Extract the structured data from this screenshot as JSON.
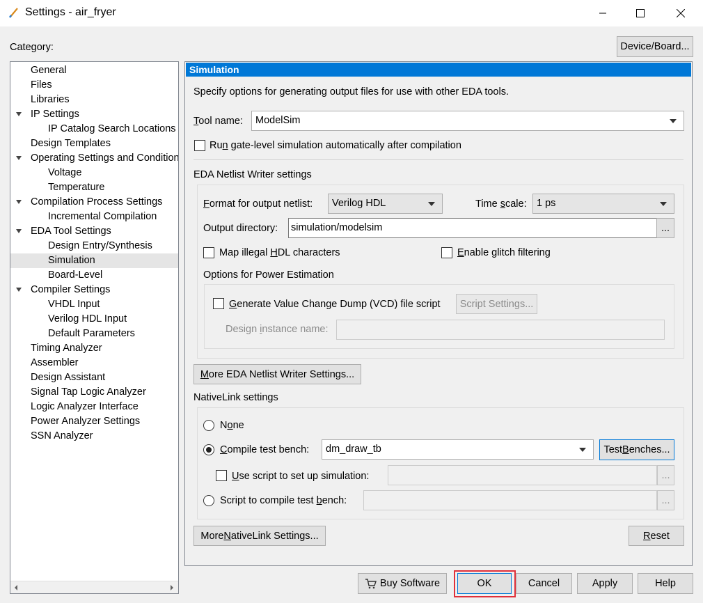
{
  "window": {
    "title": "Settings - air_fryer",
    "minimize": "—",
    "maximize": "☐",
    "close": "✕"
  },
  "category_label": "Category:",
  "device_board_button": "Device/Board...",
  "tree": [
    {
      "label": "General",
      "level": 0
    },
    {
      "label": "Files",
      "level": 0
    },
    {
      "label": "Libraries",
      "level": 0
    },
    {
      "label": "IP Settings",
      "level": 0,
      "expanded": true
    },
    {
      "label": "IP Catalog Search Locations",
      "level": 1
    },
    {
      "label": "Design Templates",
      "level": 0
    },
    {
      "label": "Operating Settings and Conditions",
      "level": 0,
      "expanded": true
    },
    {
      "label": "Voltage",
      "level": 1
    },
    {
      "label": "Temperature",
      "level": 1
    },
    {
      "label": "Compilation Process Settings",
      "level": 0,
      "expanded": true
    },
    {
      "label": "Incremental Compilation",
      "level": 1
    },
    {
      "label": "EDA Tool Settings",
      "level": 0,
      "expanded": true
    },
    {
      "label": "Design Entry/Synthesis",
      "level": 1
    },
    {
      "label": "Simulation",
      "level": 1,
      "selected": true
    },
    {
      "label": "Board-Level",
      "level": 1
    },
    {
      "label": "Compiler Settings",
      "level": 0,
      "expanded": true
    },
    {
      "label": "VHDL Input",
      "level": 1
    },
    {
      "label": "Verilog HDL Input",
      "level": 1
    },
    {
      "label": "Default Parameters",
      "level": 1
    },
    {
      "label": "Timing Analyzer",
      "level": 0
    },
    {
      "label": "Assembler",
      "level": 0
    },
    {
      "label": "Design Assistant",
      "level": 0
    },
    {
      "label": "Signal Tap Logic Analyzer",
      "level": 0
    },
    {
      "label": "Logic Analyzer Interface",
      "level": 0
    },
    {
      "label": "Power Analyzer Settings",
      "level": 0
    },
    {
      "label": "SSN Analyzer",
      "level": 0
    }
  ],
  "panel": {
    "header": "Simulation",
    "description": "Specify options for generating output files for use with other EDA tools.",
    "tool_name": {
      "label_key": "T",
      "label_rest": "ool name:",
      "value": "ModelSim"
    },
    "run_gate_level": {
      "pre": "Ru",
      "key": "n",
      "post": " gate-level simulation automatically after compilation"
    },
    "netlist_section": "EDA Netlist Writer settings",
    "format": {
      "key": "F",
      "rest": "ormat for output netlist:",
      "value": "Verilog HDL"
    },
    "timescale": {
      "pre": "Time ",
      "key": "s",
      "post": "cale:",
      "value": "1 ps"
    },
    "output_dir": {
      "label": "Output directory:",
      "value": "simulation/modelsim",
      "browse": "..."
    },
    "map_illegal": {
      "pre": "Map illegal ",
      "key": "H",
      "post": "DL characters"
    },
    "glitch": {
      "key": "E",
      "rest": "nable glitch filtering"
    },
    "power_section": "Options for Power Estimation",
    "vcd": {
      "key": "G",
      "rest": "enerate Value Change Dump (VCD) file script",
      "script_settings": "Script Settings..."
    },
    "design_instance": {
      "pre": "Design ",
      "key": "i",
      "post": "nstance name:",
      "value": ""
    },
    "more_netlist": {
      "pre": "",
      "key": "M",
      "post": "ore EDA Netlist Writer Settings..."
    },
    "nativelink_section": "NativeLink settings",
    "none": {
      "pre": "N",
      "key": "o",
      "post": "ne"
    },
    "compile_tb": {
      "key": "C",
      "rest": "ompile test bench:",
      "value": "dm_draw_tb",
      "test_benches_pre": "Test ",
      "test_benches_key": "B",
      "test_benches_post": "enches..."
    },
    "use_script": {
      "key": "U",
      "rest": "se script to set up simulation:",
      "value": "",
      "browse": "..."
    },
    "script_compile": {
      "pre": "Script to compile test ",
      "key": "b",
      "post": "ench:",
      "value": "",
      "browse": "..."
    },
    "more_nativelink": {
      "pre": "More ",
      "key": "N",
      "post": "ativeLink Settings..."
    },
    "reset": {
      "key": "R",
      "rest": "eset"
    }
  },
  "footer": {
    "buy_software": "Buy Software",
    "ok": "OK",
    "cancel": "Cancel",
    "apply": "Apply",
    "help": "Help"
  },
  "colors": {
    "accent": "#0078d7",
    "highlight_box": "#e0303a"
  }
}
